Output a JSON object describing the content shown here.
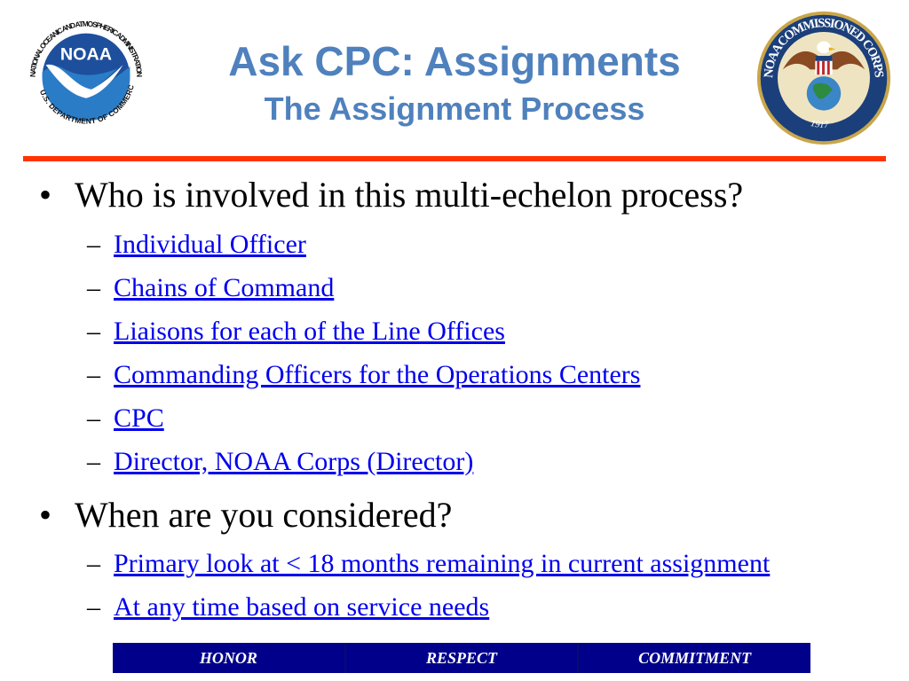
{
  "header": {
    "title": "Ask CPC: Assignments",
    "subtitle": "The Assignment Process",
    "left_logo": {
      "name": "noaa-logo",
      "center_text": "NOAA",
      "ring_text": "NATIONAL OCEANIC AND ATMOSPHERIC ADMINISTRATION",
      "bottom_text": "U.S. DEPARTMENT OF COMMERCE"
    },
    "right_logo": {
      "name": "noaa-commissioned-corps-seal",
      "ring_text": "NOAA COMMISSIONED CORPS",
      "year": "1917"
    },
    "accent_color": "#4f81bd",
    "rule_color": "#ff3300"
  },
  "body": {
    "bullets": [
      {
        "text": "Who is involved in this multi-echelon process?",
        "items": [
          "Individual Officer",
          "Chains of Command",
          "Liaisons for each of the Line Offices",
          "Commanding Officers for the Operations Centers",
          "CPC",
          "Director, NOAA Corps (Director)"
        ]
      },
      {
        "text": "When are you considered?",
        "items": [
          "Primary look at < 18 months remaining in current assignment",
          "At any time based on service needs"
        ]
      }
    ],
    "link_color": "#0000ee"
  },
  "footer": {
    "values": [
      "HONOR",
      "RESPECT",
      "COMMITMENT"
    ],
    "background": "#00008b"
  }
}
